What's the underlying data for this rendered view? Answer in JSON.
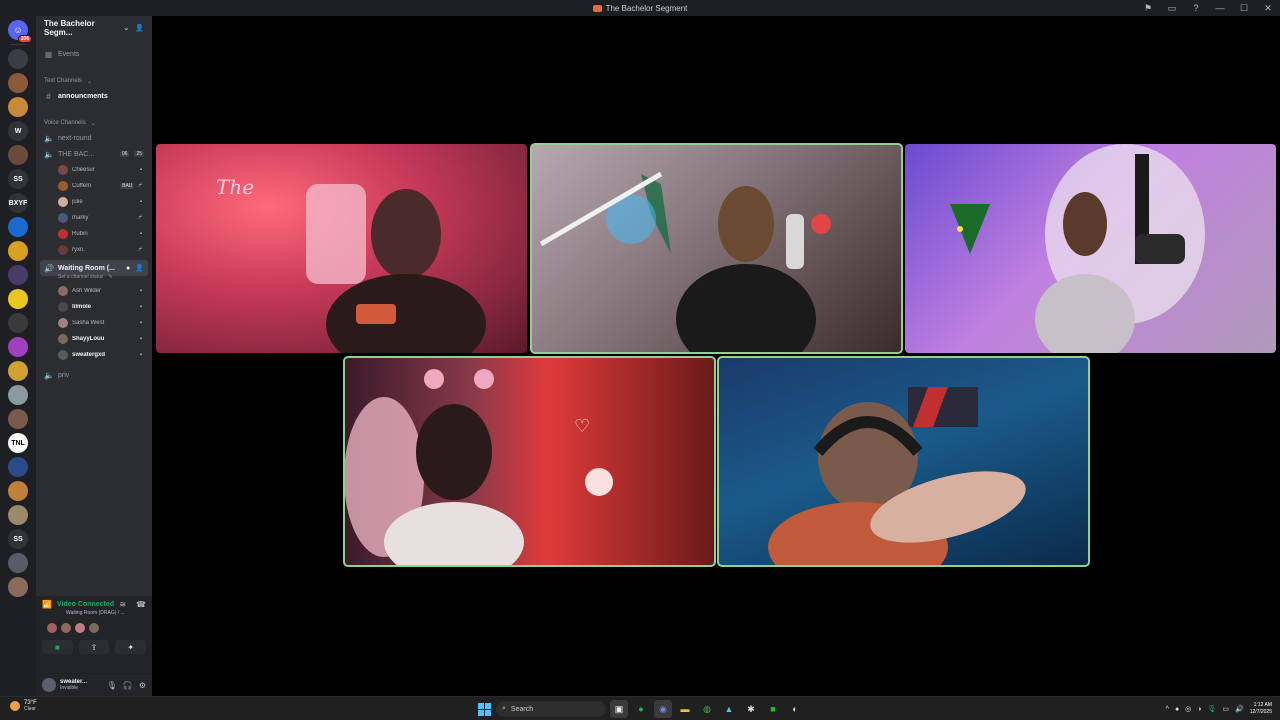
{
  "window": {
    "title": "The Bachelor Segment"
  },
  "rail": {
    "unread_badge": "106",
    "guilds": [
      {
        "label": "",
        "color": "#3a3d44"
      },
      {
        "label": "",
        "color": "#8a5a3a"
      },
      {
        "label": "",
        "color": "#c88a3a"
      },
      {
        "label": "W",
        "color": "#313338"
      },
      {
        "label": "",
        "color": "#6a4a3a"
      },
      {
        "label": "SS",
        "color": "#313338"
      },
      {
        "label": "BXYF",
        "color": "#313338"
      },
      {
        "label": "",
        "color": "#1a6ad0"
      },
      {
        "label": "",
        "color": "#d8a020"
      },
      {
        "label": "",
        "color": "#4a3a6a"
      },
      {
        "label": "",
        "color": "#e8c820"
      },
      {
        "label": "",
        "color": "#3a3a3a"
      },
      {
        "label": "",
        "color": "#a040c0"
      },
      {
        "label": "",
        "color": "#d0a030"
      },
      {
        "label": "",
        "color": "#8a9aa0"
      },
      {
        "label": "",
        "color": "#7a5a4a"
      },
      {
        "label": "TNL",
        "color": "#ffffff"
      },
      {
        "label": "",
        "color": "#2a4a8a"
      },
      {
        "label": "",
        "color": "#c0803a"
      },
      {
        "label": "",
        "color": "#9a8a6a"
      },
      {
        "label": "SS",
        "color": "#313338"
      },
      {
        "label": "",
        "color": "#5a5a6a"
      },
      {
        "label": "",
        "color": "#8a6a5a"
      }
    ]
  },
  "server": {
    "name": "The Bachelor Segm...",
    "events_label": "Events",
    "text_category": "Text Channels",
    "text_channels": [
      "announcments"
    ],
    "voice_category": "Voice Channels",
    "voice_channel_1": "next-round",
    "voice_channel_2": "THE BAC...",
    "voice_channel_2_tags": [
      "06",
      "25"
    ],
    "voice_channel_2_members": [
      {
        "name": "Cheesur",
        "color": "#7a4a4a",
        "tag": ""
      },
      {
        "name": "Cuffem",
        "color": "#a05a30",
        "tag": "BAU"
      },
      {
        "name": "julie",
        "color": "#c9b0a0",
        "tag": ""
      },
      {
        "name": "marky",
        "color": "#4a5a7a",
        "tag": ""
      },
      {
        "name": "Rubin",
        "color": "#c03030",
        "tag": ""
      },
      {
        "name": "ryxn.",
        "color": "#6a3a3a",
        "tag": ""
      }
    ],
    "waiting_room": "Waiting Room (...",
    "waiting_room_status": "Set a channel status",
    "waiting_room_members": [
      {
        "name": "Ash Wilder",
        "color": "#8a6a6a"
      },
      {
        "name": "lilmole",
        "color": "#4a4a4a"
      },
      {
        "name": "Sasha West",
        "color": "#a08080"
      },
      {
        "name": "ShayyLouu",
        "color": "#7a6a5a"
      },
      {
        "name": "sweatergxd",
        "color": "#5a5a5a"
      }
    ],
    "voice_channel_3": "priv"
  },
  "voice_panel": {
    "status": "Video Connected",
    "channel": "Waiting Room (DRAG) / ...",
    "avatar_colors": [
      "#a06060",
      "#8a6a5a",
      "#c08080",
      "#7a6a5a"
    ]
  },
  "user": {
    "name": "sweater...",
    "status": "Invisible"
  },
  "taskbar": {
    "weather_temp": "73°F",
    "weather_desc": "Clear",
    "search_placeholder": "Search",
    "time": "1:12 AM",
    "date": "12/7/2025"
  }
}
